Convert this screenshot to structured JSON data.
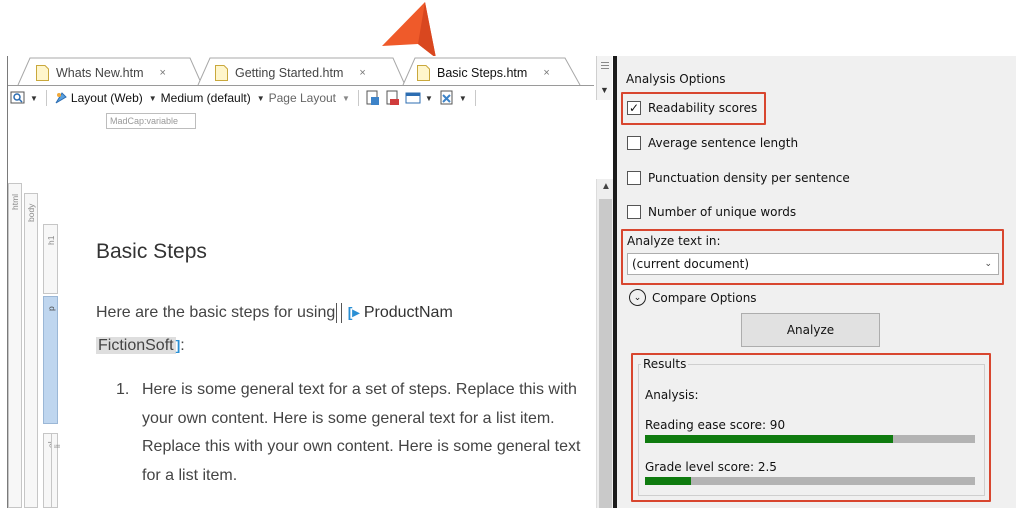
{
  "tabs": [
    {
      "label": "Whats New.htm",
      "close": "×"
    },
    {
      "label": "Getting Started.htm",
      "close": "×"
    },
    {
      "label": "Basic Steps.htm",
      "close": "×",
      "active": true
    }
  ],
  "toolbar": {
    "layout": "Layout (Web)",
    "medium": "Medium (default)",
    "page_layout": "Page Layout"
  },
  "variable_chip": "MadCap:variable",
  "structure": {
    "html": "html",
    "body": "body",
    "h1": "h1",
    "p": "p",
    "ol": "ol",
    "li": "li"
  },
  "document": {
    "title": "Basic Steps",
    "para_prefix": "Here are the basic steps for using",
    "variable_name": "ProductNam",
    "variable_value": "FictionSoft",
    "para_suffix": ":",
    "list_number": "1.",
    "list_item": "Here is some general text for a set of steps. Replace this with your own content. Here is some general text for a list item. Replace this with your own content. Here is some general text for a list item."
  },
  "panel": {
    "title": "Analysis Options",
    "options": [
      {
        "label": "Readability scores",
        "checked": true
      },
      {
        "label": "Average sentence length",
        "checked": false
      },
      {
        "label": "Punctuation density per sentence",
        "checked": false
      },
      {
        "label": "Number of unique words",
        "checked": false
      }
    ],
    "analyze_text_label": "Analyze text in:",
    "analyze_text_value": "(current document)",
    "compare_label": "Compare Options",
    "analyze_button": "Analyze",
    "results": {
      "legend": "Results",
      "analysis_label": "Analysis:",
      "reading_ease_label": "Reading ease score: 90",
      "reading_ease_fraction": 0.75,
      "grade_level_label": "Grade level score: 2.5",
      "grade_level_fraction": 0.14
    }
  },
  "colors": {
    "highlight": "#d8462f",
    "progress_fill": "#0f7b0f",
    "progress_track": "#b3b3b3",
    "variable_tag": "#2a8fd4"
  }
}
